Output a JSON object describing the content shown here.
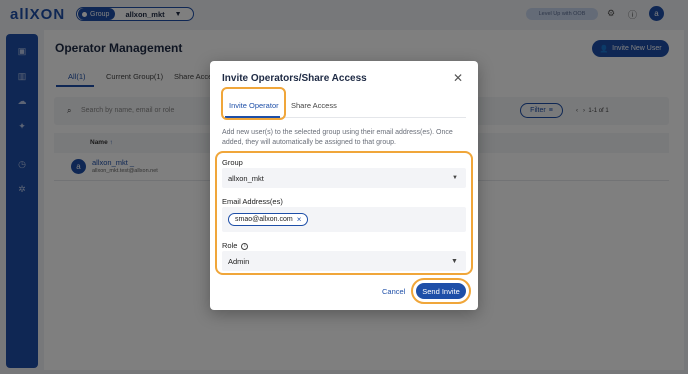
{
  "app": {
    "logo": "allXON",
    "group_tag": "Group",
    "group_name": "allxon_mkt",
    "level_up": "Level Up with OOB",
    "user_initial": "a"
  },
  "page": {
    "title": "Operator Management",
    "invite_new_user": "Invite New User",
    "tabs": [
      "All(1)",
      "Current Group(1)",
      "Share Acce"
    ],
    "search_placeholder": "Search by name, email or role",
    "filter": "Filter",
    "pagination": "1-1 of 1",
    "column_name": "Name",
    "row": {
      "initial": "a",
      "name": "allxon_mkt _",
      "email": "allxon_mkt.test@allxon.net"
    }
  },
  "modal": {
    "title": "Invite Operators/Share Access",
    "tabs": [
      "Invite Operator",
      "Share Access"
    ],
    "description": "Add new user(s) to the selected group using their email address(es). Once added, they will automatically be assigned to that group.",
    "group_label": "Group",
    "group_value": "allxon_mkt",
    "email_label": "Email Address(es)",
    "email_chip": "smao@allxon.com",
    "role_label": "Role",
    "role_value": "Admin",
    "cancel": "Cancel",
    "send_invite": "Send Invite"
  },
  "colors": {
    "brand": "#1e4fa8",
    "highlight": "#f0a63a",
    "overlay": "rgba(0,0,0,0.5)"
  }
}
